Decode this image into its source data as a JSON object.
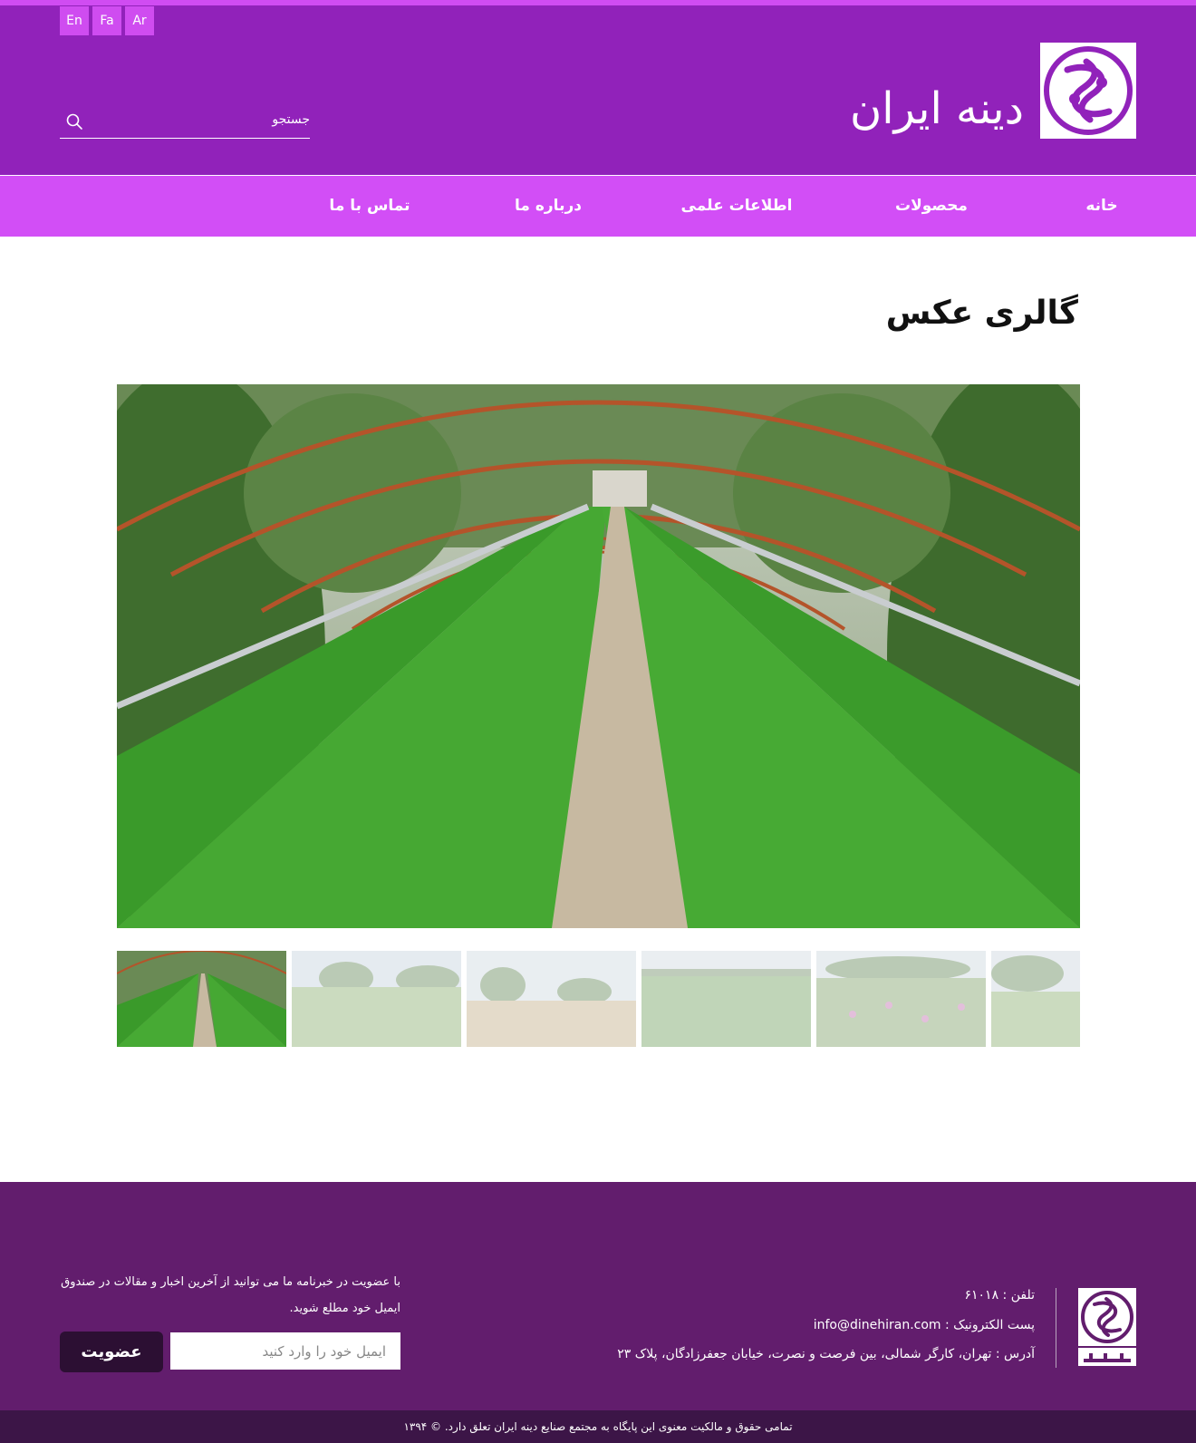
{
  "header": {
    "languages": [
      "En",
      "Fa",
      "Ar"
    ],
    "search_placeholder": "جستجو",
    "logo_text": "دینه ایران"
  },
  "nav": {
    "items": [
      "خانه",
      "محصولات",
      "اطلاعات علمی",
      "درباره ما",
      "تماس با ما"
    ]
  },
  "main": {
    "title": "گالری عکس",
    "thumbnail_count": 6
  },
  "footer": {
    "phone": "تلفن : ۶۱۰۱۸",
    "email": "پست الکترونیک : info@dinehiran.com",
    "address": "آدرس : تهران، کارگر شمالی، بین فرصت و نصرت، خیابان جعفرزادگان، پلاک ۲۳",
    "newsletter_text": "با عضویت در خبرنامه ما می توانید از آخرین اخبار و مقالات در صندوق ایمیل خود مطلع شوید.",
    "email_placeholder": "ایمیل خود را وارد کنید",
    "subscribe_label": "عضویت",
    "copyright": "تمامی حقوق و مالکیت معنوی این پایگاه به مجتمع صنایع دینه ایران تعلق دارد. © ۱۳۹۴"
  },
  "colors": {
    "header_bg": "#9122ba",
    "nav_bg": "#d24ef6",
    "accent": "#cf4cf0",
    "footer_bg": "#621d6d",
    "copyright_bg": "#3c1547",
    "button_dark": "#2c0f33"
  }
}
